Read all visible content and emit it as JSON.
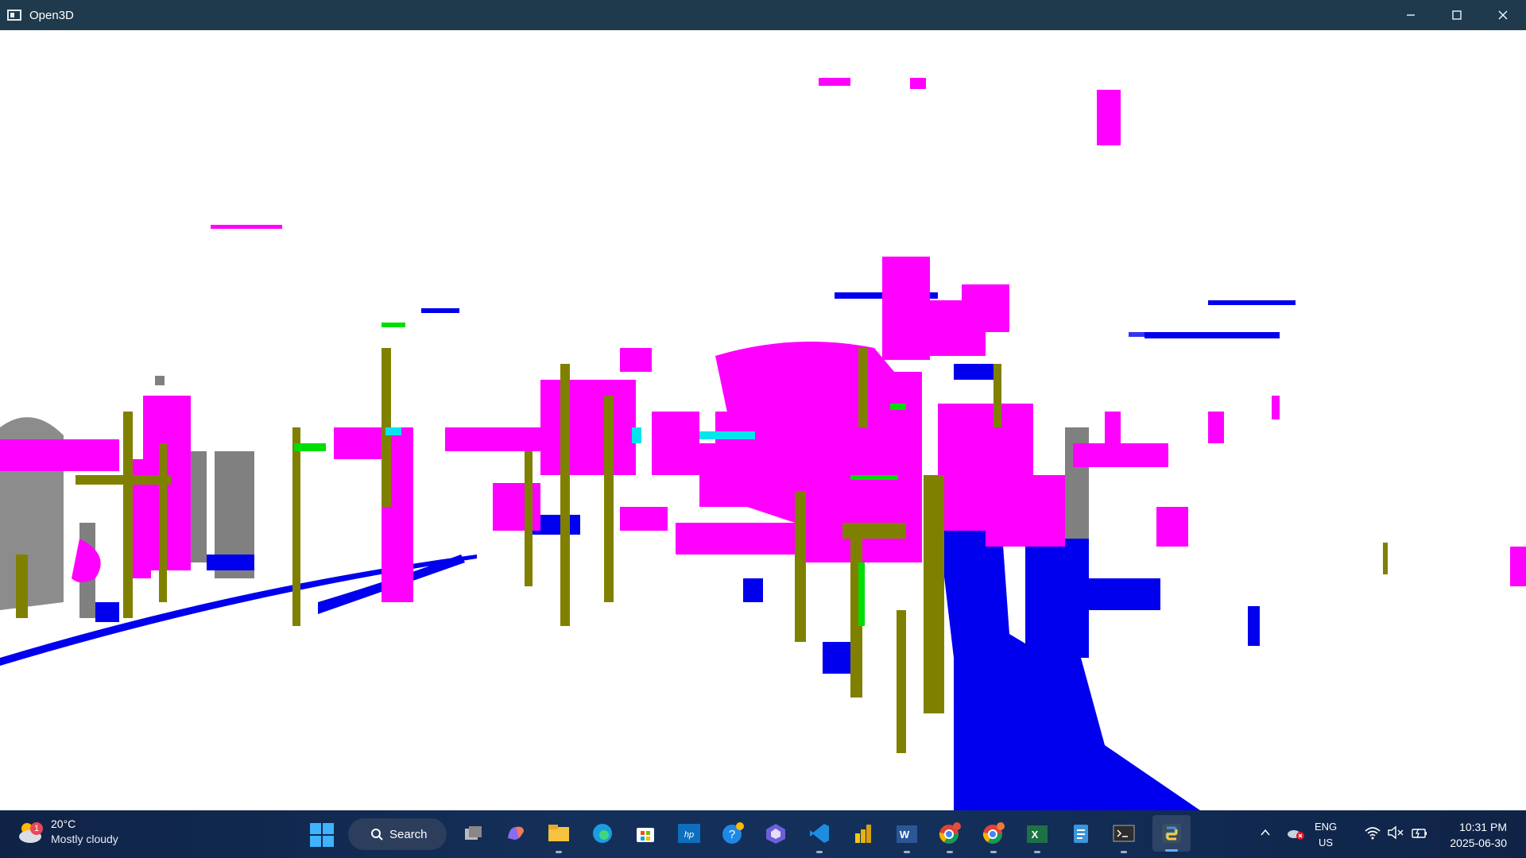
{
  "window": {
    "title": "Open3D",
    "controls": {
      "minimize": "minimize-icon",
      "maximize": "maximize-icon",
      "close": "close-icon"
    }
  },
  "viewport": {
    "content": "3D point cloud rendering",
    "colors": {
      "magenta": "#ff00ff",
      "blue": "#0000ee",
      "olive": "#808000",
      "gray": "#808080",
      "green": "#00dd00",
      "cyan": "#00e5ee",
      "background": "#ffffff"
    }
  },
  "taskbar": {
    "weather": {
      "temp": "20°C",
      "desc": "Mostly cloudy",
      "badge": "1"
    },
    "search": {
      "label": "Search"
    },
    "apps": [
      {
        "name": "task-view-icon"
      },
      {
        "name": "copilot-icon"
      },
      {
        "name": "file-explorer-icon"
      },
      {
        "name": "edge-icon"
      },
      {
        "name": "store-icon"
      },
      {
        "name": "myhp-icon"
      },
      {
        "name": "help-icon"
      },
      {
        "name": "copilot-app-icon"
      },
      {
        "name": "vscode-icon"
      },
      {
        "name": "power-bi-icon"
      },
      {
        "name": "word-icon"
      },
      {
        "name": "chrome-icon"
      },
      {
        "name": "chrome-profile-icon"
      },
      {
        "name": "excel-icon"
      },
      {
        "name": "notepad-icon"
      },
      {
        "name": "terminal-icon"
      },
      {
        "name": "python-icon"
      }
    ],
    "tray": {
      "lang": "ENG",
      "region": "US",
      "time": "10:31 PM",
      "date": "2025-06-30"
    }
  }
}
